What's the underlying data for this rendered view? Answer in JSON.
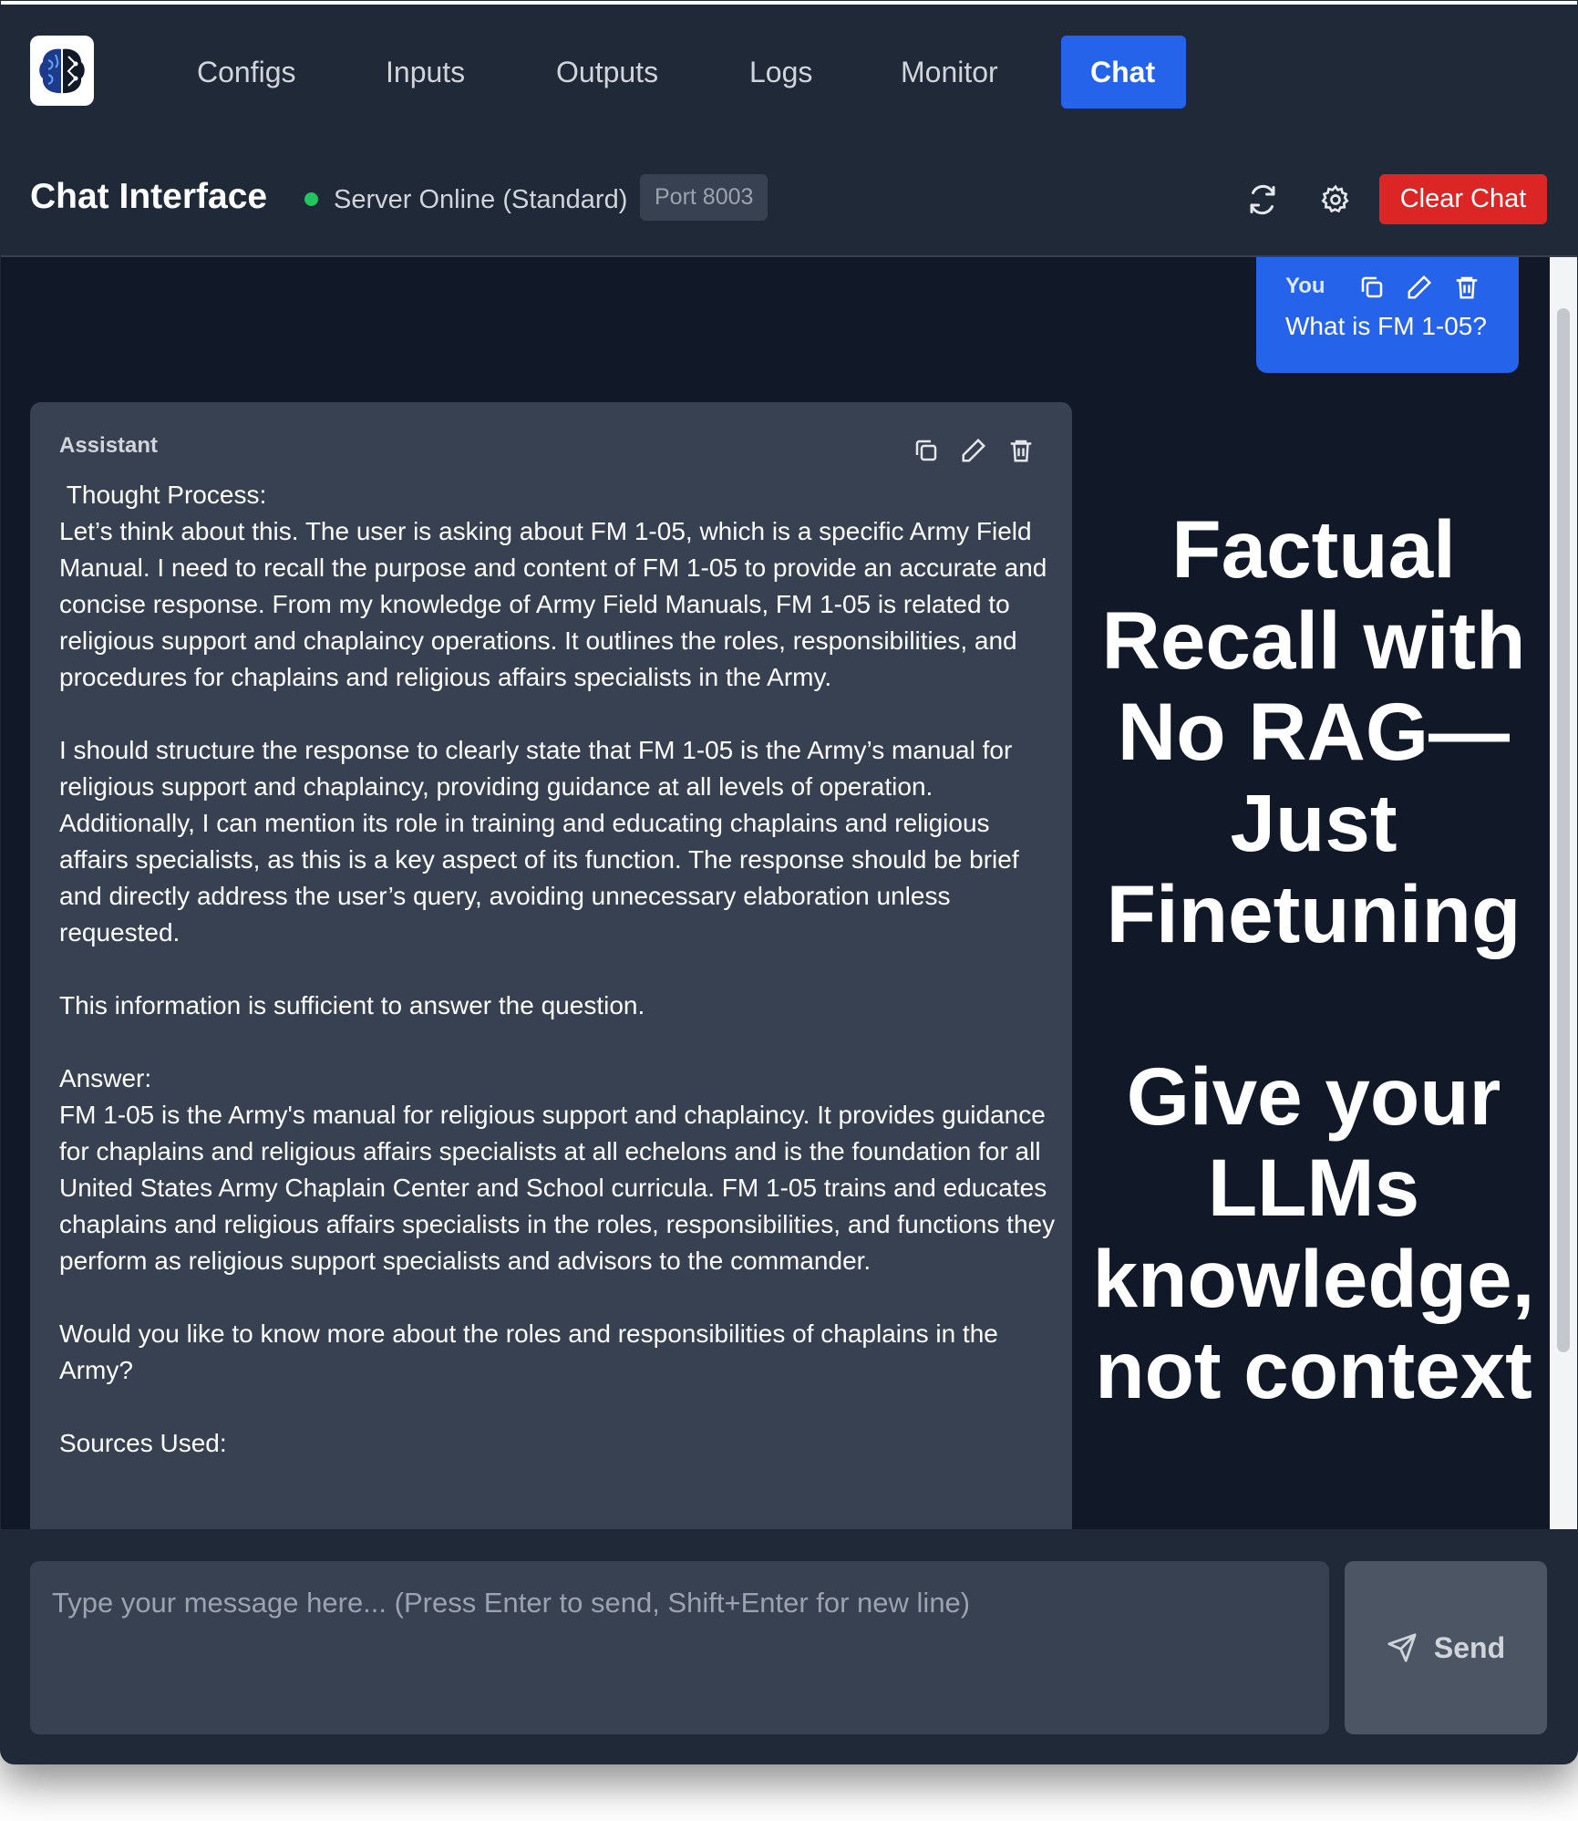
{
  "nav": {
    "items": [
      {
        "label": "Configs"
      },
      {
        "label": "Inputs"
      },
      {
        "label": "Outputs"
      },
      {
        "label": "Logs"
      },
      {
        "label": "Monitor"
      },
      {
        "label": "Chat",
        "active": true
      }
    ]
  },
  "header": {
    "title": "Chat Interface",
    "status": "Server Online (Standard)",
    "port": "Port 8003",
    "clear_label": "Clear Chat"
  },
  "messages": {
    "user": {
      "role": "You",
      "text": "What is FM 1-05?"
    },
    "assistant": {
      "role": "Assistant",
      "text": " Thought Process:\nLet’s think about this. The user is asking about FM 1-05, which is a specific Army Field Manual. I need to recall the purpose and content of FM 1-05 to provide an accurate and concise response. From my knowledge of Army Field Manuals, FM 1-05 is related to religious support and chaplaincy operations. It outlines the roles, responsibilities, and procedures for chaplains and religious affairs specialists in the Army.\n\nI should structure the response to clearly state that FM 1-05 is the Army’s manual for religious support and chaplaincy, providing guidance at all levels of operation. Additionally, I can mention its role in training and educating chaplains and religious affairs specialists, as this is a key aspect of its function. The response should be brief and directly address the user’s query, avoiding unnecessary elaboration unless requested.\n\nThis information is sufficient to answer the question.\n\nAnswer:\nFM 1-05 is the Army's manual for religious support and chaplaincy. It provides guidance for chaplains and religious affairs specialists at all echelons and is the foundation for all United States Army Chaplain Center and School curricula. FM 1-05 trains and educates chaplains and religious affairs specialists in the roles, responsibilities, and functions they perform as religious support specialists and advisors to the commander.\n\nWould you like to know more about the roles and responsibilities of chaplains in the Army?\n\nSources Used:"
    }
  },
  "overlay": {
    "lines": [
      "Factual",
      "Recall with",
      "No RAG—",
      "Just",
      "Finetuning",
      "",
      "Give your",
      "LLMs",
      "knowledge,",
      "not context"
    ]
  },
  "composer": {
    "placeholder": "Type your message here... (Press Enter to send, Shift+Enter for new line)",
    "send_label": "Send"
  },
  "colors": {
    "accent": "#2563eb",
    "danger": "#dc2626",
    "online": "#22c55e",
    "background": "#111827",
    "panel": "#1f2937"
  },
  "icons": [
    "brain-logo-icon",
    "refresh-icon",
    "gear-icon",
    "copy-icon",
    "edit-icon",
    "trash-icon",
    "send-icon"
  ]
}
